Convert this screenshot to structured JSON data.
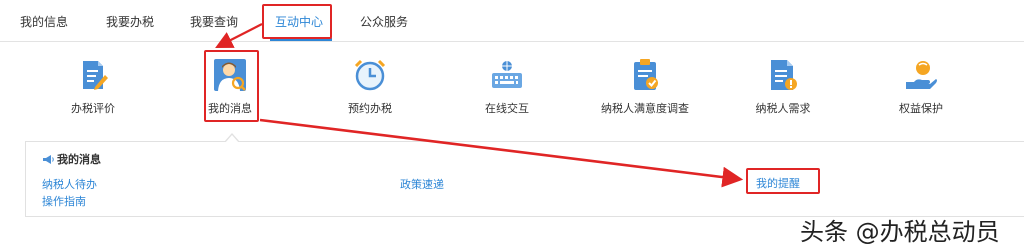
{
  "tabs": [
    {
      "label": "我的信息"
    },
    {
      "label": "我要办税"
    },
    {
      "label": "我要查询"
    },
    {
      "label": "互动中心"
    },
    {
      "label": "公众服务"
    }
  ],
  "active_tab": "互动中心",
  "icon_items": [
    {
      "label": "办税评价",
      "icon": "pen-document-icon"
    },
    {
      "label": "我的消息",
      "icon": "user-message-icon"
    },
    {
      "label": "预约办税",
      "icon": "alarm-clock-icon"
    },
    {
      "label": "在线交互",
      "icon": "keyboard-globe-icon"
    },
    {
      "label": "纳税人满意度调查",
      "icon": "survey-clipboard-icon"
    },
    {
      "label": "纳税人需求",
      "icon": "document-request-icon"
    },
    {
      "label": "权益保护",
      "icon": "hand-protect-icon"
    }
  ],
  "panel": {
    "title": "我的消息",
    "links": {
      "pending": "纳税人待办",
      "guide": "操作指南",
      "policy": "政策速递",
      "reminder": "我的提醒"
    }
  },
  "watermark": "头条 @办税总动员",
  "colors": {
    "accent": "#2d86d6",
    "annotation": "#e02525"
  }
}
